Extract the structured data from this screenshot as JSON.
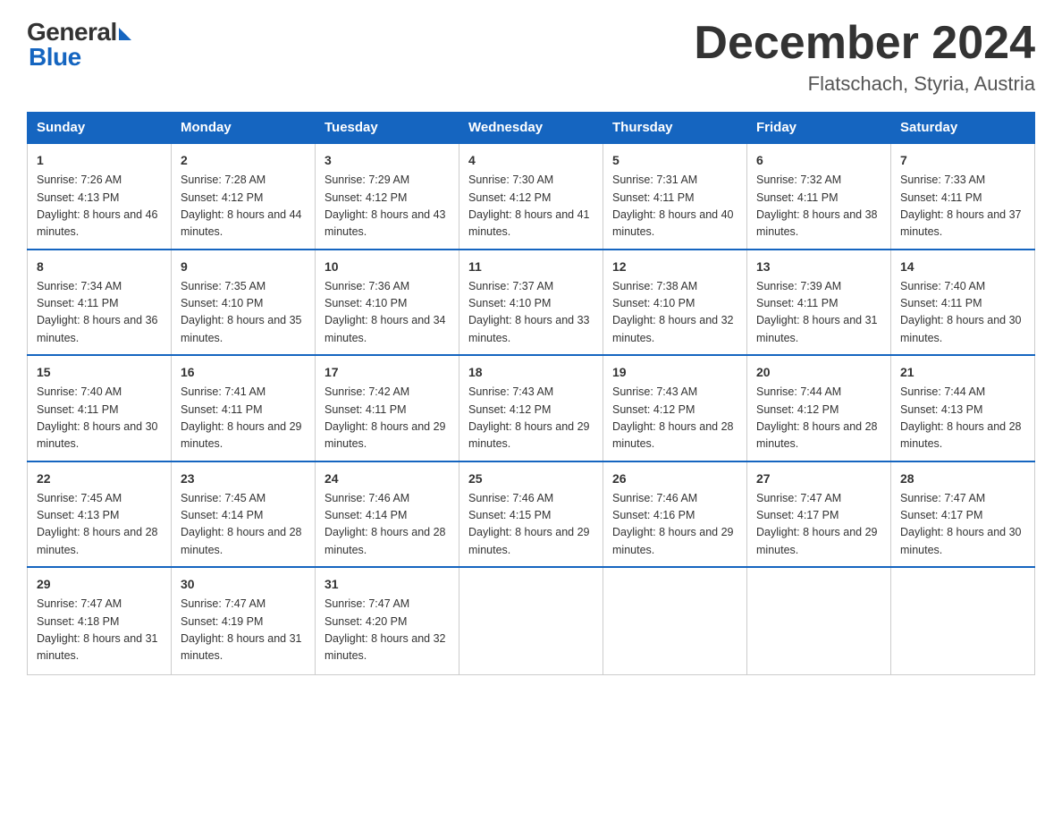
{
  "logo": {
    "text_general": "General",
    "text_blue": "Blue"
  },
  "header": {
    "month_year": "December 2024",
    "location": "Flatschach, Styria, Austria"
  },
  "weekdays": [
    "Sunday",
    "Monday",
    "Tuesday",
    "Wednesday",
    "Thursday",
    "Friday",
    "Saturday"
  ],
  "weeks": [
    [
      {
        "day": "1",
        "sunrise": "7:26 AM",
        "sunset": "4:13 PM",
        "daylight": "8 hours and 46 minutes."
      },
      {
        "day": "2",
        "sunrise": "7:28 AM",
        "sunset": "4:12 PM",
        "daylight": "8 hours and 44 minutes."
      },
      {
        "day": "3",
        "sunrise": "7:29 AM",
        "sunset": "4:12 PM",
        "daylight": "8 hours and 43 minutes."
      },
      {
        "day": "4",
        "sunrise": "7:30 AM",
        "sunset": "4:12 PM",
        "daylight": "8 hours and 41 minutes."
      },
      {
        "day": "5",
        "sunrise": "7:31 AM",
        "sunset": "4:11 PM",
        "daylight": "8 hours and 40 minutes."
      },
      {
        "day": "6",
        "sunrise": "7:32 AM",
        "sunset": "4:11 PM",
        "daylight": "8 hours and 38 minutes."
      },
      {
        "day": "7",
        "sunrise": "7:33 AM",
        "sunset": "4:11 PM",
        "daylight": "8 hours and 37 minutes."
      }
    ],
    [
      {
        "day": "8",
        "sunrise": "7:34 AM",
        "sunset": "4:11 PM",
        "daylight": "8 hours and 36 minutes."
      },
      {
        "day": "9",
        "sunrise": "7:35 AM",
        "sunset": "4:10 PM",
        "daylight": "8 hours and 35 minutes."
      },
      {
        "day": "10",
        "sunrise": "7:36 AM",
        "sunset": "4:10 PM",
        "daylight": "8 hours and 34 minutes."
      },
      {
        "day": "11",
        "sunrise": "7:37 AM",
        "sunset": "4:10 PM",
        "daylight": "8 hours and 33 minutes."
      },
      {
        "day": "12",
        "sunrise": "7:38 AM",
        "sunset": "4:10 PM",
        "daylight": "8 hours and 32 minutes."
      },
      {
        "day": "13",
        "sunrise": "7:39 AM",
        "sunset": "4:11 PM",
        "daylight": "8 hours and 31 minutes."
      },
      {
        "day": "14",
        "sunrise": "7:40 AM",
        "sunset": "4:11 PM",
        "daylight": "8 hours and 30 minutes."
      }
    ],
    [
      {
        "day": "15",
        "sunrise": "7:40 AM",
        "sunset": "4:11 PM",
        "daylight": "8 hours and 30 minutes."
      },
      {
        "day": "16",
        "sunrise": "7:41 AM",
        "sunset": "4:11 PM",
        "daylight": "8 hours and 29 minutes."
      },
      {
        "day": "17",
        "sunrise": "7:42 AM",
        "sunset": "4:11 PM",
        "daylight": "8 hours and 29 minutes."
      },
      {
        "day": "18",
        "sunrise": "7:43 AM",
        "sunset": "4:12 PM",
        "daylight": "8 hours and 29 minutes."
      },
      {
        "day": "19",
        "sunrise": "7:43 AM",
        "sunset": "4:12 PM",
        "daylight": "8 hours and 28 minutes."
      },
      {
        "day": "20",
        "sunrise": "7:44 AM",
        "sunset": "4:12 PM",
        "daylight": "8 hours and 28 minutes."
      },
      {
        "day": "21",
        "sunrise": "7:44 AM",
        "sunset": "4:13 PM",
        "daylight": "8 hours and 28 minutes."
      }
    ],
    [
      {
        "day": "22",
        "sunrise": "7:45 AM",
        "sunset": "4:13 PM",
        "daylight": "8 hours and 28 minutes."
      },
      {
        "day": "23",
        "sunrise": "7:45 AM",
        "sunset": "4:14 PM",
        "daylight": "8 hours and 28 minutes."
      },
      {
        "day": "24",
        "sunrise": "7:46 AM",
        "sunset": "4:14 PM",
        "daylight": "8 hours and 28 minutes."
      },
      {
        "day": "25",
        "sunrise": "7:46 AM",
        "sunset": "4:15 PM",
        "daylight": "8 hours and 29 minutes."
      },
      {
        "day": "26",
        "sunrise": "7:46 AM",
        "sunset": "4:16 PM",
        "daylight": "8 hours and 29 minutes."
      },
      {
        "day": "27",
        "sunrise": "7:47 AM",
        "sunset": "4:17 PM",
        "daylight": "8 hours and 29 minutes."
      },
      {
        "day": "28",
        "sunrise": "7:47 AM",
        "sunset": "4:17 PM",
        "daylight": "8 hours and 30 minutes."
      }
    ],
    [
      {
        "day": "29",
        "sunrise": "7:47 AM",
        "sunset": "4:18 PM",
        "daylight": "8 hours and 31 minutes."
      },
      {
        "day": "30",
        "sunrise": "7:47 AM",
        "sunset": "4:19 PM",
        "daylight": "8 hours and 31 minutes."
      },
      {
        "day": "31",
        "sunrise": "7:47 AM",
        "sunset": "4:20 PM",
        "daylight": "8 hours and 32 minutes."
      },
      null,
      null,
      null,
      null
    ]
  ]
}
